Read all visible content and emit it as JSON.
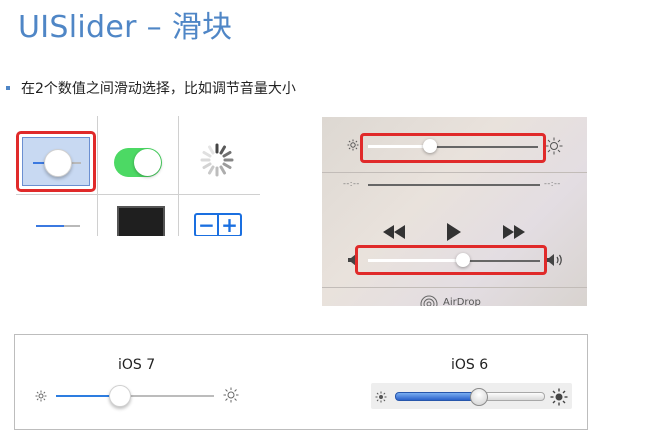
{
  "title": "UISlider – 滑块",
  "bullet": "在2个数值之间滑动选择，比如调节音量大小",
  "control_grid": {
    "highlight_color": "#e02a2a",
    "icons": [
      "slider-icon",
      "toggle-switch-icon",
      "activity-spinner-icon",
      "slider-icon",
      "dark-tile-icon",
      "stepper-icon"
    ],
    "stepper": {
      "minus": "−",
      "plus": "+"
    }
  },
  "control_center": {
    "icons": [
      "brightness-low-icon",
      "brightness-high-icon",
      "rewind-icon",
      "play-icon",
      "fast-forward-icon",
      "volume-low-icon",
      "volume-high-icon",
      "airdrop-icon"
    ],
    "scrubber_left": "--:--",
    "scrubber_right": "--:--",
    "airdrop_label": "AirDrop",
    "brightness_level": 0.4,
    "volume_level": 0.55
  },
  "comparison": {
    "ios7_label": "iOS 7",
    "ios6_label": "iOS 6",
    "ios7_level": 0.4,
    "ios6_level": 0.55,
    "accent_ios7": "#2d7de0",
    "accent_ios6": "#2b62c9"
  }
}
